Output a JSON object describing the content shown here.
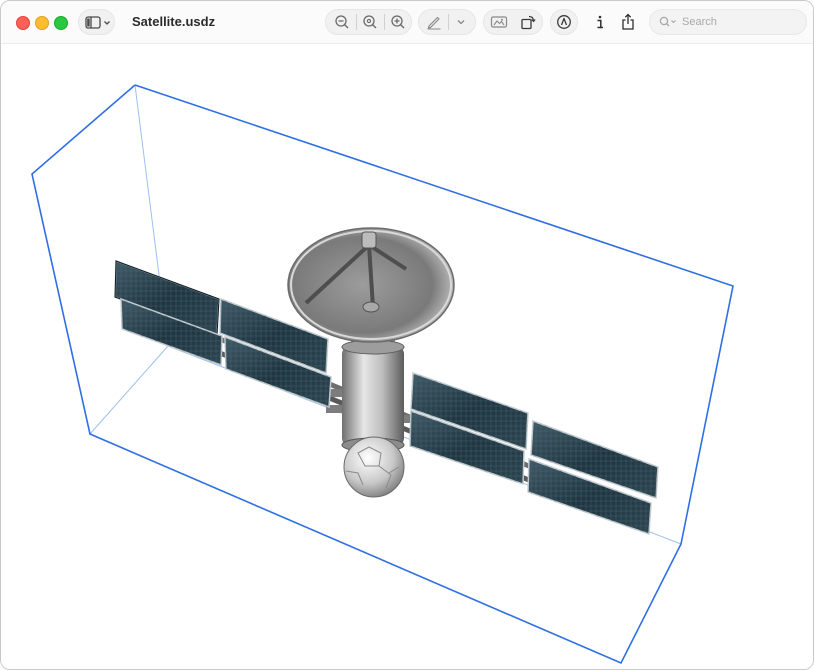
{
  "window": {
    "title": "Satellite.usdz"
  },
  "toolbar": {
    "sidebar_toggle": "sidebar-icon",
    "zoom_out": "zoom-out-icon",
    "actual_size": "zoom-reset-icon",
    "zoom_in": "zoom-in-icon",
    "markup": "pencil-icon",
    "markup_menu": "chevron-down-icon",
    "scene_mode": "ar-scene-icon",
    "rotate": "rotate-icon",
    "annotate": "markup-circle-icon",
    "info": "info-icon",
    "share": "share-icon"
  },
  "search": {
    "placeholder": "Search"
  },
  "colors": {
    "bounding_box": "#2f6fe4",
    "close": "#fe5f57",
    "minimize": "#febc2e",
    "maximize": "#28c840"
  }
}
